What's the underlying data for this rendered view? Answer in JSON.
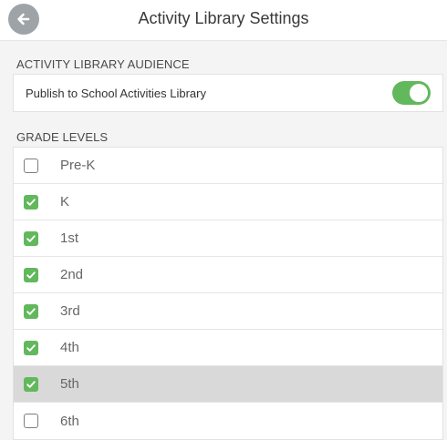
{
  "header": {
    "title": "Activity Library Settings",
    "back_icon": "back-arrow-icon"
  },
  "audience": {
    "section_label": "ACTIVITY LIBRARY AUDIENCE",
    "publish_label": "Publish to School Activities Library",
    "publish_enabled": true
  },
  "grades": {
    "section_label": "GRADE LEVELS",
    "items": [
      {
        "label": "Pre-K",
        "checked": false
      },
      {
        "label": "K",
        "checked": true
      },
      {
        "label": "1st",
        "checked": true
      },
      {
        "label": "2nd",
        "checked": true
      },
      {
        "label": "3rd",
        "checked": true
      },
      {
        "label": "4th",
        "checked": true
      },
      {
        "label": "5th",
        "checked": true,
        "highlighted": true
      },
      {
        "label": "6th",
        "checked": false
      }
    ]
  },
  "colors": {
    "accent_green": "#62b85d",
    "back_button_gray": "#9ea3a8",
    "highlight_row": "#d9d9d9"
  }
}
